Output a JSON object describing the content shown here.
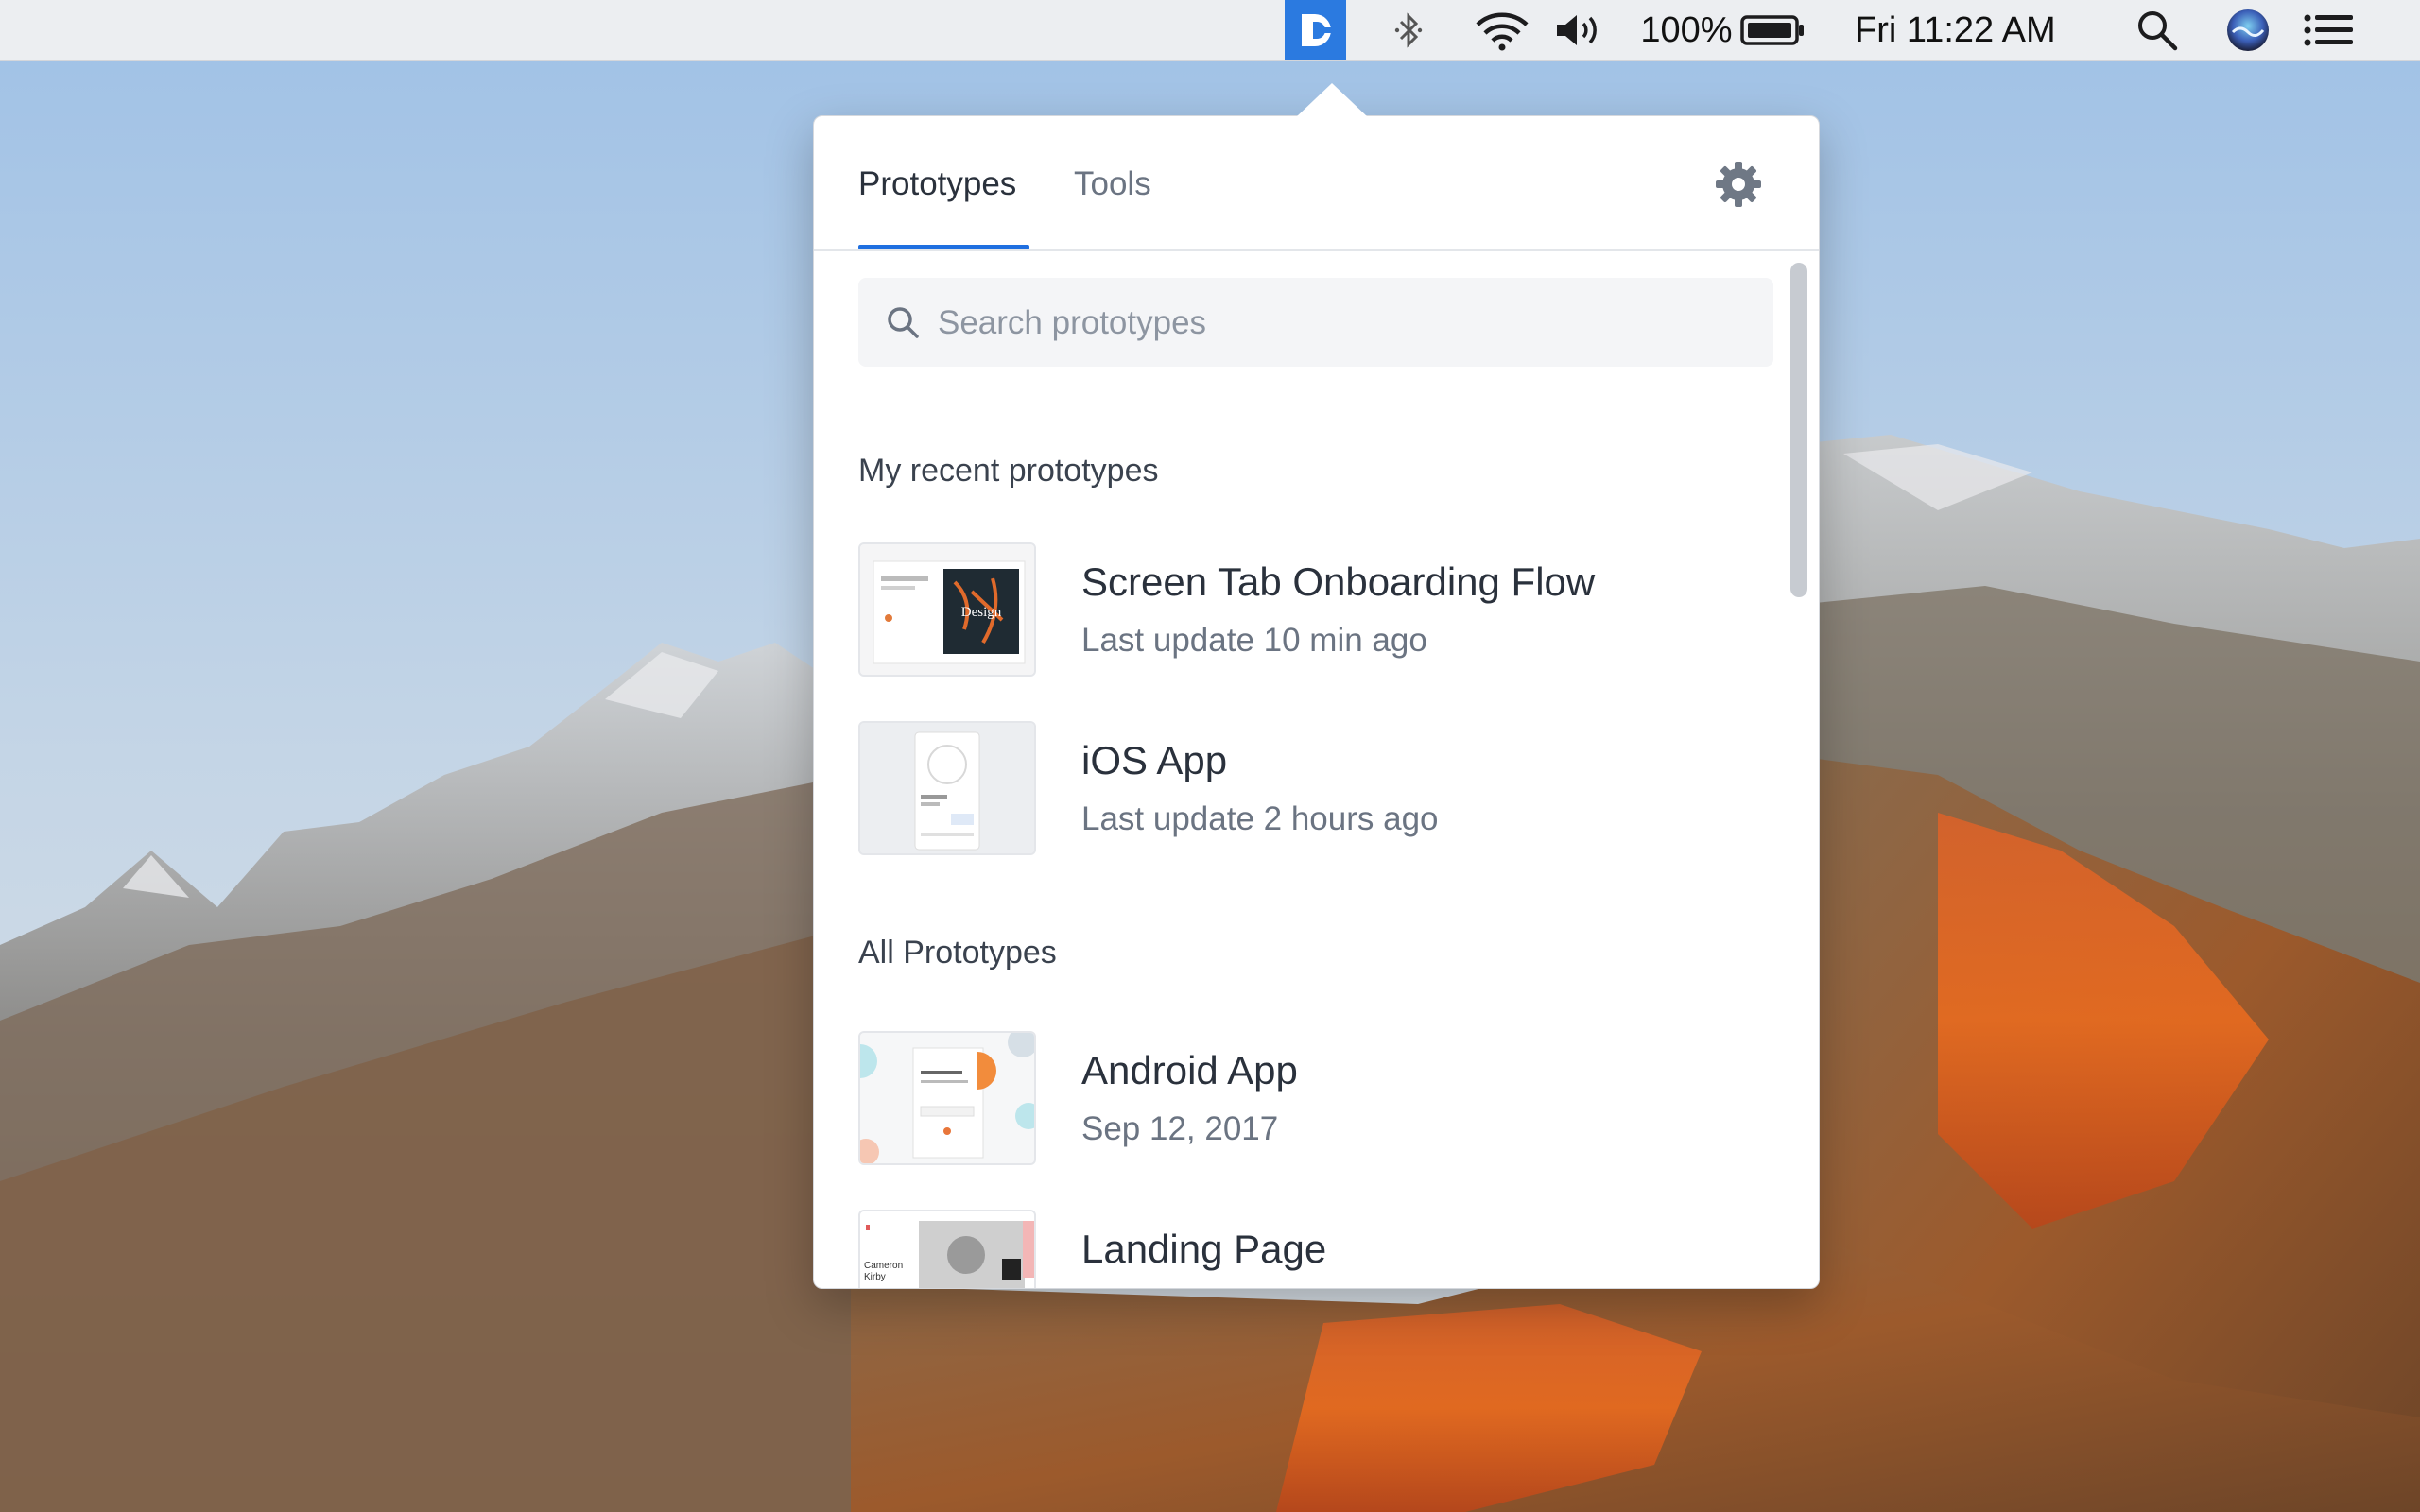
{
  "menubar": {
    "app_icon": "screen-app-icon",
    "bluetooth_icon": "bluetooth-icon",
    "wifi_icon": "wifi-icon",
    "volume_icon": "volume-icon",
    "battery_percent": "100%",
    "battery_icon": "battery-icon",
    "clock": "Fri 11:22 AM",
    "spotlight_icon": "search-icon",
    "siri_icon": "siri-icon",
    "notification_icon": "list-icon",
    "accent_color": "#2b7ae0"
  },
  "popover": {
    "tabs": [
      {
        "label": "Prototypes",
        "active": true
      },
      {
        "label": "Tools",
        "active": false
      }
    ],
    "settings_icon": "gear-icon",
    "accent_color": "#1f6fe0",
    "search": {
      "placeholder": "Search prototypes",
      "value": ""
    },
    "recent_section_title": "My recent prototypes",
    "recent": [
      {
        "name": "Screen Tab Onboarding Flow",
        "meta": "Last update 10 min ago"
      },
      {
        "name": "iOS App",
        "meta": "Last update 2 hours ago"
      }
    ],
    "all_section_title": "All Prototypes",
    "all": [
      {
        "name": "Android App",
        "meta": "Sep 12, 2017"
      },
      {
        "name": "Landing Page",
        "meta": ""
      }
    ]
  }
}
